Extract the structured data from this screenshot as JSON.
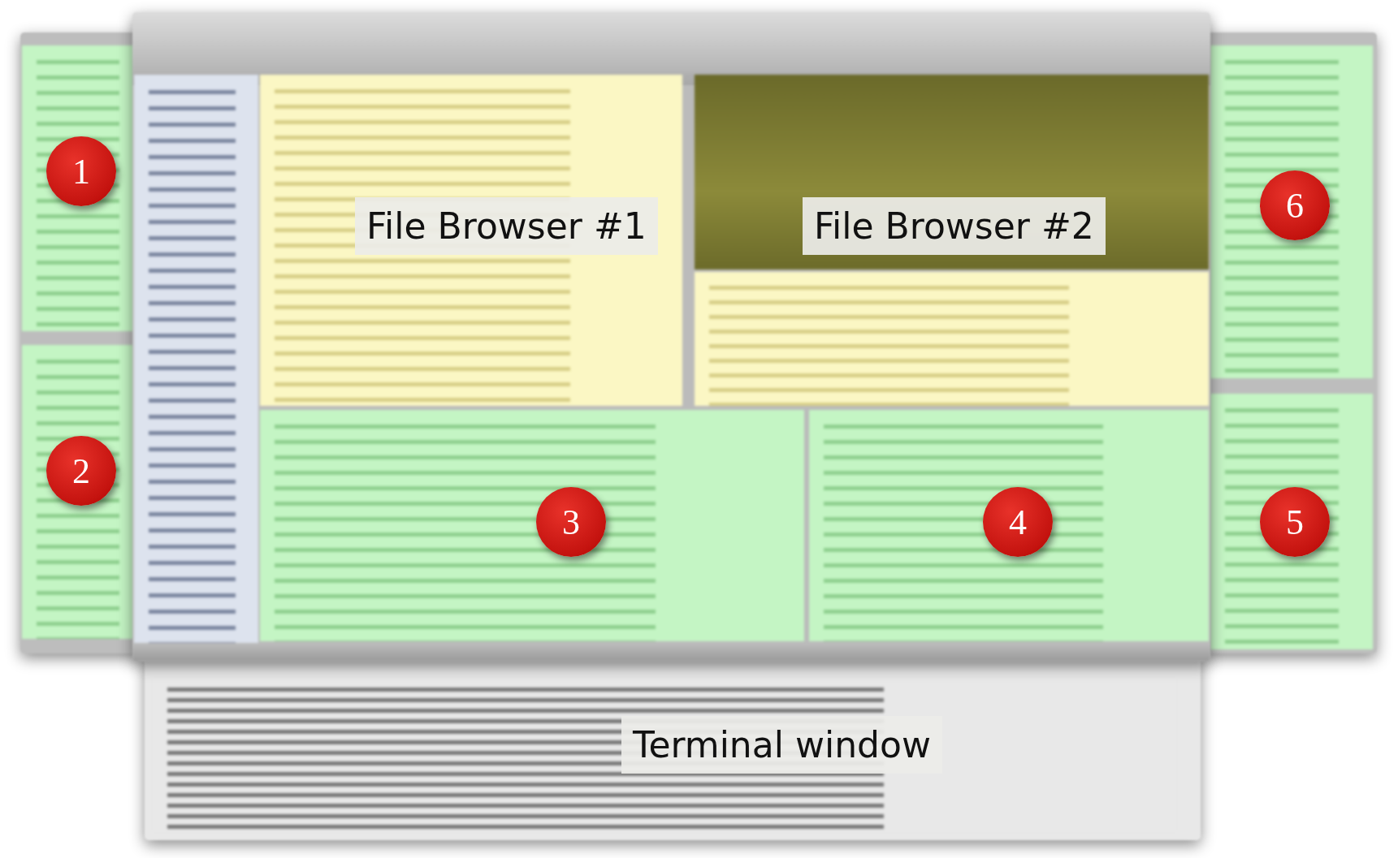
{
  "annotations": [
    {
      "number": "1"
    },
    {
      "number": "2"
    },
    {
      "number": "3"
    },
    {
      "number": "4"
    },
    {
      "number": "5"
    },
    {
      "number": "6"
    }
  ],
  "callouts": [
    {
      "text": "File Browser #1"
    },
    {
      "text": "File Browser #2"
    },
    {
      "text": "Terminal window"
    }
  ]
}
